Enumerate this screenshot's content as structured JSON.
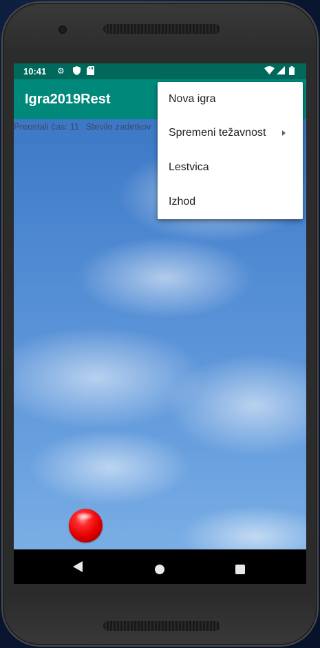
{
  "status_bar": {
    "time": "10:41",
    "left_icons": [
      "gear-icon",
      "shield-icon",
      "sd-card-icon"
    ],
    "right_icons": [
      "wifi-icon",
      "signal-icon",
      "battery-icon"
    ]
  },
  "app_bar": {
    "title": "Igra2019Rest",
    "color": "#00897b",
    "status_color": "#00695c"
  },
  "hud": {
    "time_left": "Preostali čas: 11",
    "hits": "Stevilo zadetkov"
  },
  "overflow_menu": {
    "items": [
      {
        "label": "Nova igra",
        "has_submenu": false
      },
      {
        "label": "Spremeni težavnost",
        "has_submenu": true
      },
      {
        "label": "Lestvica",
        "has_submenu": false
      },
      {
        "label": "Izhod",
        "has_submenu": false
      }
    ]
  },
  "game": {
    "target": "red-ball",
    "target_color": "#e30000"
  },
  "nav_bar": {
    "buttons": [
      "back-icon",
      "home-icon",
      "recents-icon"
    ]
  }
}
